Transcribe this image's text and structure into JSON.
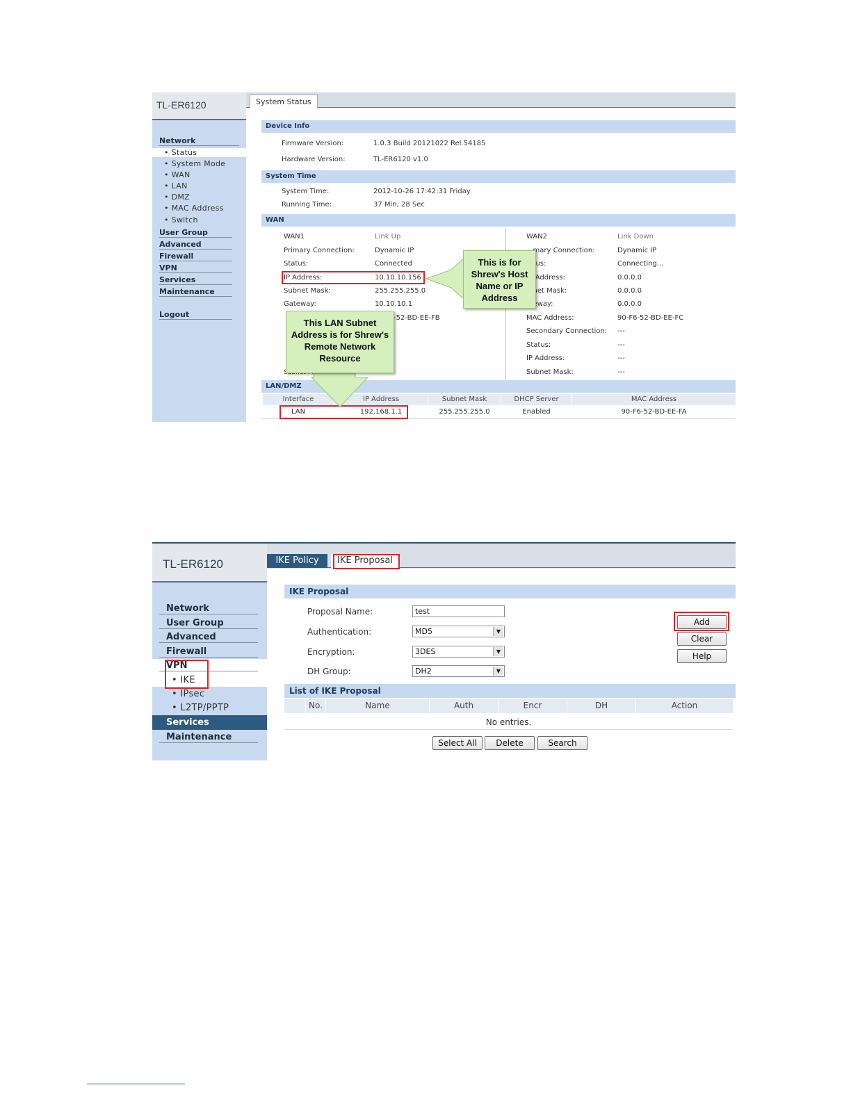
{
  "status_screen": {
    "logo": "TL-ER6120",
    "tab": "System Status",
    "sidebar": {
      "categories": [
        "Network",
        "User Group",
        "Advanced",
        "Firewall",
        "VPN",
        "Services",
        "Maintenance",
        "Logout"
      ],
      "network_items": [
        "Status",
        "System Mode",
        "WAN",
        "LAN",
        "DMZ",
        "MAC Address",
        "Switch"
      ],
      "active_item": "Status"
    },
    "device_info": {
      "heading": "Device Info",
      "firmware_label": "Firmware Version:",
      "firmware_value": "1.0.3 Build 20121022 Rel.54185",
      "hardware_label": "Hardware Version:",
      "hardware_value": "TL-ER6120 v1.0"
    },
    "system_time": {
      "heading": "System Time",
      "system_time_label": "System Time:",
      "system_time_value": "2012-10-26 17:42:31 Friday",
      "running_time_label": "Running Time:",
      "running_time_value": "37 Min, 28 Sec"
    },
    "wan": {
      "heading": "WAN",
      "wan1": {
        "name": "WAN1",
        "link": "Link Up",
        "primary_label": "Primary Connection:",
        "primary_value": "Dynamic IP",
        "status_label": "Status:",
        "status_value": "Connected",
        "ip_label": "IP Address:",
        "ip_value": "10.10.10.156",
        "mask_label": "Subnet Mask:",
        "mask_value": "255.255.255.0",
        "gateway_label": "Gateway:",
        "gateway_value": "10.10.10.1",
        "mac_partial": "-52-BD-EE-FB",
        "subnet_partial": "Subnet Mask",
        "subnet_partial_value": "---"
      },
      "wan2": {
        "name": "WAN2",
        "link": "Link Down",
        "primary_label": "...mary Connection:",
        "primary_value": "Dynamic IP",
        "status_label": "...tus:",
        "status_value": "Connecting...",
        "ip_label": "... Address:",
        "ip_value": "0.0.0.0",
        "mask_label": "...net Mask:",
        "mask_value": "0.0.0.0",
        "gateway_label": "...eway:",
        "gateway_value": "0.0.0.0",
        "mac_label": "MAC Address:",
        "mac_value": "90-F6-52-BD-EE-FC",
        "secondary_label": "Secondary Connection:",
        "secondary_value": "---",
        "status2_label": "Status:",
        "status2_value": "---",
        "ip2_label": "IP Address:",
        "ip2_value": "---",
        "mask2_label": "Subnet Mask:",
        "mask2_value": "---"
      }
    },
    "lan_dmz": {
      "heading": "LAN/DMZ",
      "columns": [
        "Interface",
        "IP Address",
        "Subnet Mask",
        "DHCP Server",
        "MAC Address"
      ],
      "row": [
        "LAN",
        "192.168.1.1",
        "255.255.255.0",
        "Enabled",
        "90-F6-52-BD-EE-FA"
      ]
    },
    "callout_host": "This is for Shrew's Host Name or IP Address",
    "callout_lan": "This LAN Subnet Address is for Shrew's Remote Network Resource",
    "callout_colors": {
      "fill": "#d6f0bd",
      "border": "#9dc078"
    },
    "highlight_color": "#d9262b"
  },
  "ike_screen": {
    "logo": "TL-ER6120",
    "tabs": [
      "IKE Policy",
      "IKE Proposal"
    ],
    "active_tab": "IKE Policy",
    "sidebar": {
      "categories": [
        "Network",
        "User Group",
        "Advanced",
        "Firewall",
        "VPN",
        "Services",
        "Maintenance"
      ],
      "vpn_items": [
        "IKE",
        "IPsec",
        "L2TP/PPTP"
      ],
      "active_item": "IKE"
    },
    "proposal": {
      "heading": "IKE Proposal",
      "name_label": "Proposal Name:",
      "name_value": "test",
      "auth_label": "Authentication:",
      "auth_value": "MD5",
      "encr_label": "Encryption:",
      "encr_value": "3DES",
      "dh_label": "DH Group:",
      "dh_value": "DH2"
    },
    "buttons": {
      "add": "Add",
      "clear": "Clear",
      "help": "Help"
    },
    "list": {
      "heading": "List of IKE Proposal",
      "columns": [
        "No.",
        "Name",
        "Auth",
        "Encr",
        "DH",
        "Action"
      ],
      "empty": "No entries."
    },
    "bottom_buttons": {
      "select_all": "Select All",
      "delete": "Delete",
      "search": "Search"
    }
  }
}
